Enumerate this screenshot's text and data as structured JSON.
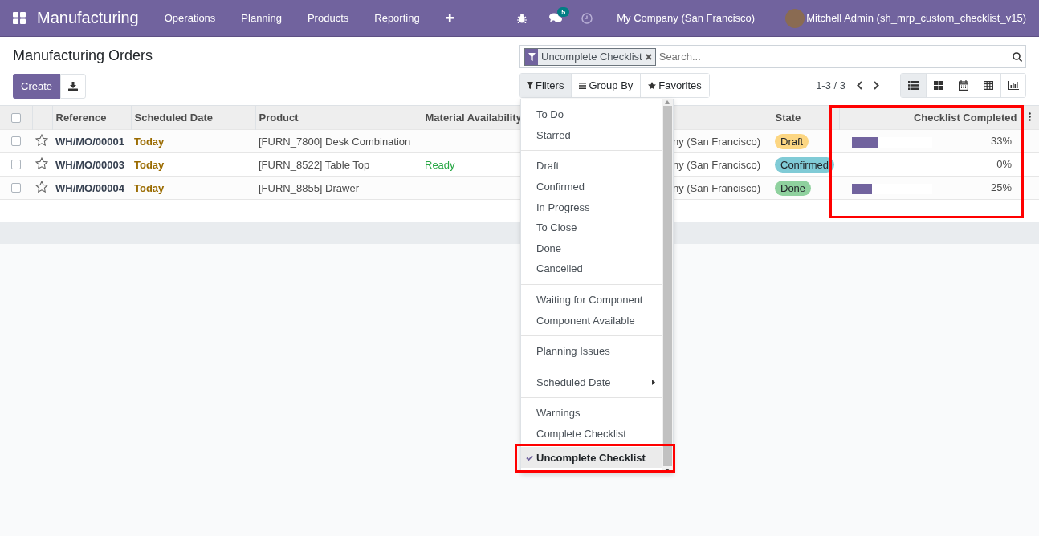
{
  "navbar": {
    "app_title": "Manufacturing",
    "menu": [
      "Operations",
      "Planning",
      "Products",
      "Reporting"
    ],
    "plus": "✚",
    "messages_count": "5",
    "company": "My Company (San Francisco)",
    "user": "Mitchell Admin (sh_mrp_custom_checklist_v15)"
  },
  "page_title": "Manufacturing Orders",
  "create_button": "Create",
  "search": {
    "facet": "Uncomplete Checklist",
    "placeholder": "Search..."
  },
  "search_buttons": [
    {
      "label": "Filters",
      "kind": "filter",
      "selected": true
    },
    {
      "label": "Group By",
      "kind": "group",
      "selected": false
    },
    {
      "label": "Favorites",
      "kind": "star",
      "selected": false
    }
  ],
  "pager": "1-3 / 3",
  "views": [
    {
      "kind": "list",
      "selected": true
    },
    {
      "kind": "kanban",
      "selected": false
    },
    {
      "kind": "calendar",
      "selected": false
    },
    {
      "kind": "pivot",
      "selected": false
    },
    {
      "kind": "graph",
      "selected": false
    }
  ],
  "table": {
    "all_checked": false,
    "columns": [
      "Reference",
      "Scheduled Date",
      "Product",
      "Material Availability",
      "State",
      "Checklist Completed"
    ],
    "rows": [
      {
        "checked": false,
        "reference": "WH/MO/00001",
        "date": "Today",
        "product": "[FURN_7800] Desk Combination",
        "company": "ny (San Francisco)",
        "state": {
          "label": "Draft",
          "kind": "draft"
        },
        "level": 0.33,
        "reading": "33%"
      },
      {
        "checked": false,
        "reference": "WH/MO/00003",
        "date": "Today",
        "product": "[FURN_8522] Table Top",
        "material": "Ready",
        "company": "ny (San Francisco)",
        "state": {
          "label": "Confirmed",
          "kind": "confirmed"
        },
        "level": 0,
        "reading": "0%"
      },
      {
        "checked": false,
        "reference": "WH/MO/00004",
        "date": "Today",
        "product": "[FURN_8855] Drawer",
        "company": "ny (San Francisco)",
        "state": {
          "label": "Done",
          "kind": "done"
        },
        "level": 0.25,
        "reading": "25%"
      }
    ]
  },
  "filters_menu": [
    [
      {
        "label": "To Do",
        "kind": "option",
        "selected": false
      },
      {
        "label": "Starred",
        "kind": "option",
        "selected": false
      }
    ],
    [
      {
        "label": "Draft",
        "kind": "option",
        "selected": false
      },
      {
        "label": "Confirmed",
        "kind": "option",
        "selected": false
      },
      {
        "label": "In Progress",
        "kind": "option",
        "selected": false
      },
      {
        "label": "To Close",
        "kind": "option",
        "selected": false
      },
      {
        "label": "Done",
        "kind": "option",
        "selected": false
      },
      {
        "label": "Cancelled",
        "kind": "option",
        "selected": false
      }
    ],
    [
      {
        "label": "Waiting for Component",
        "kind": "option",
        "selected": false
      },
      {
        "label": "Component Available",
        "kind": "option",
        "selected": false
      }
    ],
    [
      {
        "label": "Planning Issues",
        "kind": "option",
        "selected": false
      }
    ],
    [
      {
        "label": "Scheduled Date",
        "kind": "submenu",
        "selected": false
      }
    ],
    [
      {
        "label": "Warnings",
        "kind": "option",
        "selected": false
      },
      {
        "label": "Complete Checklist",
        "kind": "option",
        "selected": false
      },
      {
        "label": "Uncomplete Checklist",
        "kind": "option",
        "selected": true
      }
    ]
  ]
}
